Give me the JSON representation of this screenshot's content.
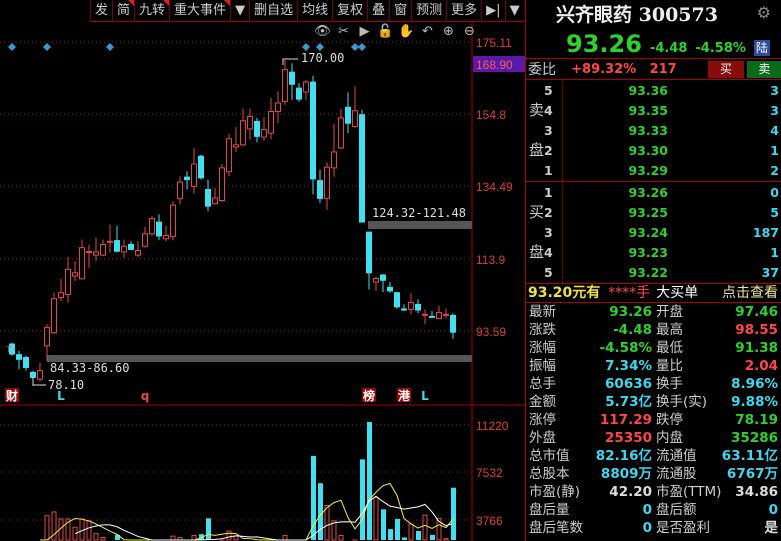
{
  "toolbar": {
    "items": [
      "发",
      "简",
      "九转",
      "重大事件",
      "▼",
      "删自选",
      "均线",
      "复权",
      "叠",
      "窗",
      "预测",
      "更多",
      "▶|",
      "▼"
    ],
    "tools": [
      "eye-icon",
      "scissors-icon",
      "play-icon",
      "lock-icon",
      "hand-icon",
      "undo-icon",
      "zoom-in-icon",
      "zoom-out-icon"
    ]
  },
  "stock": {
    "name": "兴齐眼药",
    "code": "300573",
    "price": "93.26",
    "change": "-4.48",
    "pct": "-4.58%",
    "market_badge": "陆"
  },
  "weibi": {
    "label": "委比",
    "pct": "+89.32%",
    "diff": "217",
    "buy_btn": "买",
    "sell_btn": "卖"
  },
  "orderbook": {
    "sell_label": [
      "卖",
      "盘"
    ],
    "buy_label": [
      "买",
      "盘"
    ],
    "sells": [
      {
        "lv": "5",
        "price": "93.36",
        "vol": "3"
      },
      {
        "lv": "4",
        "price": "93.35",
        "vol": "3"
      },
      {
        "lv": "3",
        "price": "93.33",
        "vol": "4"
      },
      {
        "lv": "2",
        "price": "93.30",
        "vol": "1"
      },
      {
        "lv": "1",
        "price": "93.29",
        "vol": "2"
      }
    ],
    "buys": [
      {
        "lv": "1",
        "price": "93.26",
        "vol": "0"
      },
      {
        "lv": "2",
        "price": "93.25",
        "vol": "5"
      },
      {
        "lv": "3",
        "price": "93.24",
        "vol": "187"
      },
      {
        "lv": "4",
        "price": "93.23",
        "vol": "1"
      },
      {
        "lv": "5",
        "price": "93.22",
        "vol": "37"
      }
    ]
  },
  "bigorder": {
    "price": "93.20元有",
    "qty": "****手",
    "type": "大买单",
    "link": "点击查看"
  },
  "stats": [
    [
      [
        "最新",
        "93.26",
        "g"
      ],
      [
        "开盘",
        "97.46",
        "g"
      ]
    ],
    [
      [
        "涨跌",
        "-4.48",
        "g"
      ],
      [
        "最高",
        "98.55",
        "r"
      ]
    ],
    [
      [
        "涨幅",
        "-4.58%",
        "g"
      ],
      [
        "最低",
        "91.38",
        "g"
      ]
    ],
    [
      [
        "振幅",
        "7.34%",
        "c"
      ],
      [
        "量比",
        "2.04",
        "r"
      ]
    ],
    [
      [
        "总手",
        "60636",
        "c"
      ],
      [
        "换手",
        "8.96%",
        "c"
      ]
    ],
    [
      [
        "金额",
        "5.73亿",
        "c"
      ],
      [
        "换手(实)",
        "9.88%",
        "c"
      ]
    ],
    [
      [
        "涨停",
        "117.29",
        "r"
      ],
      [
        "跌停",
        "78.19",
        "g"
      ]
    ],
    [
      [
        "外盘",
        "25350",
        "r"
      ],
      [
        "内盘",
        "35286",
        "g"
      ]
    ],
    [
      [
        "总市值",
        "82.16亿",
        "c"
      ],
      [
        "流通值",
        "63.11亿",
        "c"
      ]
    ],
    [
      [
        "总股本",
        "8809万",
        "c"
      ],
      [
        "流通股",
        "6767万",
        "c"
      ]
    ],
    [
      [
        "市盈(静)",
        "42.20",
        "w"
      ],
      [
        "市盈(TTM)",
        "34.86",
        "w"
      ]
    ],
    [
      [
        "盘后量",
        "0",
        "c"
      ],
      [
        "盘后额",
        "0",
        "c"
      ]
    ],
    [
      [
        "盘后笔数",
        "0",
        "c"
      ],
      [
        "是否盈利",
        "是",
        "w"
      ]
    ]
  ],
  "colors": {
    "up": "#e04848",
    "down": "#40e0f0",
    "grid": "#8a1a1a",
    "axis": "#e03a3a",
    "highlight": "#5a1aa8"
  },
  "chart_data": {
    "type": "candlestick",
    "price_ticks": [
      175.11,
      154.8,
      134.49,
      113.9,
      93.59
    ],
    "price_range": [
      175.11,
      93.59
    ],
    "current_price_tag": "168.90",
    "volume_ticks": [
      11220,
      7532,
      3766
    ],
    "annotations": {
      "high": "170.00",
      "low": "78.10",
      "gap1": "84.33-86.60",
      "gap2": "124.32-121.48"
    },
    "gaps": [
      [
        84.33,
        86.6
      ],
      [
        121.48,
        124.32
      ]
    ],
    "markers": [
      {
        "i": 0,
        "t": "财",
        "style": "box"
      },
      {
        "i": 7,
        "t": "L",
        "style": "cyan"
      },
      {
        "i": 19,
        "t": "q",
        "style": "red"
      },
      {
        "i": 51,
        "t": "榜",
        "style": "box"
      },
      {
        "i": 56,
        "t": "港",
        "style": "box"
      },
      {
        "i": 59,
        "t": "L",
        "style": "cyan"
      }
    ],
    "signal_diamonds": [
      0,
      5,
      14,
      42,
      44,
      49,
      50
    ],
    "ohlc": [
      [
        89.9,
        90.3,
        86.6,
        87.1
      ],
      [
        86.9,
        88.0,
        82.8,
        85.6
      ],
      [
        86.1,
        86.6,
        82.4,
        83.3
      ],
      [
        81.9,
        82.4,
        78.1,
        80.5
      ],
      [
        80.0,
        84.7,
        79.3,
        82.4
      ],
      [
        89.4,
        95.5,
        85.2,
        94.6
      ],
      [
        93.1,
        104.4,
        92.7,
        102.7
      ],
      [
        103.0,
        108.3,
        102.1,
        104.4
      ],
      [
        103.9,
        114.5,
        101.6,
        111.0
      ],
      [
        109.1,
        113.3,
        107.7,
        110.0
      ],
      [
        108.3,
        119.4,
        108.2,
        117.1
      ],
      [
        115.9,
        118.0,
        111.4,
        116.0
      ],
      [
        115.0,
        119.9,
        113.3,
        115.9
      ],
      [
        115.0,
        119.4,
        114.7,
        118.0
      ],
      [
        118.8,
        123.6,
        115.7,
        118.9
      ],
      [
        119.1,
        123.2,
        115.7,
        116.1
      ],
      [
        115.9,
        119.4,
        114.3,
        117.5
      ],
      [
        118.0,
        118.9,
        116.4,
        116.6
      ],
      [
        115.0,
        118.9,
        114.5,
        116.3
      ],
      [
        117.5,
        123.0,
        117.1,
        121.0
      ],
      [
        121.0,
        126.0,
        120.4,
        125.3
      ],
      [
        124.3,
        126.5,
        119.2,
        120.4
      ],
      [
        119.6,
        123.2,
        118.9,
        120.5
      ],
      [
        120.2,
        130.2,
        119.2,
        129.1
      ],
      [
        130.9,
        137.2,
        129.3,
        135.6
      ],
      [
        137.0,
        138.6,
        133.5,
        136.3
      ],
      [
        134.4,
        145.2,
        132.4,
        140.7
      ],
      [
        142.9,
        143.3,
        136.3,
        136.8
      ],
      [
        133.5,
        136.3,
        127.4,
        128.8
      ],
      [
        129.5,
        134.0,
        129.3,
        131.1
      ],
      [
        130.4,
        140.7,
        130.0,
        139.6
      ],
      [
        138.5,
        149.2,
        137.2,
        147.8
      ],
      [
        145.5,
        151.1,
        144.0,
        146.1
      ],
      [
        146.1,
        156.3,
        145.7,
        152.9
      ],
      [
        150.6,
        156.3,
        147.6,
        154.1
      ],
      [
        152.7,
        153.7,
        146.8,
        148.5
      ],
      [
        148.3,
        153.9,
        147.3,
        150.4
      ],
      [
        149.4,
        159.3,
        147.6,
        155.5
      ],
      [
        155.5,
        161.2,
        152.2,
        157.9
      ],
      [
        158.3,
        170.0,
        157.4,
        167.3
      ],
      [
        166.6,
        169.1,
        158.8,
        163.2
      ],
      [
        162.1,
        163.5,
        158.3,
        159.0
      ],
      [
        161.0,
        164.4,
        158.8,
        163.8
      ],
      [
        163.8,
        165.6,
        132.1,
        136.5
      ],
      [
        136.0,
        139.1,
        129.7,
        131.0
      ],
      [
        131.0,
        141.2,
        127.8,
        139.8
      ],
      [
        139.6,
        152.0,
        137.1,
        144.1
      ],
      [
        145.2,
        156.2,
        144.9,
        153.7
      ],
      [
        156.7,
        160.9,
        149.4,
        152.2
      ],
      [
        151.3,
        162.6,
        150.8,
        155.7
      ],
      [
        154.6,
        156.0,
        124.3,
        124.32
      ],
      [
        121.48,
        121.48,
        105.3,
        110.0
      ],
      [
        107.4,
        108.9,
        104.9,
        108.4
      ],
      [
        109.4,
        109.6,
        104.6,
        107.9
      ],
      [
        105.9,
        107.4,
        104.4,
        104.9
      ],
      [
        104.4,
        104.6,
        99.9,
        100.4
      ],
      [
        99.8,
        101.1,
        99.2,
        99.7
      ],
      [
        99.7,
        104.2,
        98.3,
        101.6
      ],
      [
        101.1,
        102.5,
        98.6,
        99.5
      ],
      [
        98.2,
        99.7,
        95.5,
        98.3
      ],
      [
        97.7,
        99.2,
        97.4,
        97.6
      ],
      [
        97.1,
        100.7,
        96.9,
        98.8
      ],
      [
        98.1,
        99.9,
        97.1,
        98.3
      ],
      [
        98.0,
        98.55,
        91.38,
        93.26
      ]
    ],
    "volume": [
      1500,
      1400,
      1300,
      1500,
      1800,
      4100,
      4400,
      3850,
      3850,
      3200,
      3850,
      3700,
      2700,
      2400,
      1800,
      2600,
      1600,
      1500,
      1400,
      1800,
      1700,
      1600,
      1500,
      2500,
      2400,
      1700,
      2550,
      2650,
      3900,
      2000,
      2200,
      2900,
      2500,
      2000,
      1900,
      1800,
      1700,
      1800,
      1900,
      2550,
      1800,
      1700,
      1600,
      8800,
      6650,
      4900,
      3700,
      2550,
      2000,
      2200,
      8520,
      11460,
      5530,
      4600,
      3050,
      3850,
      2400,
      3450,
      2900,
      4150,
      2600,
      3900,
      2300,
      6300
    ]
  }
}
